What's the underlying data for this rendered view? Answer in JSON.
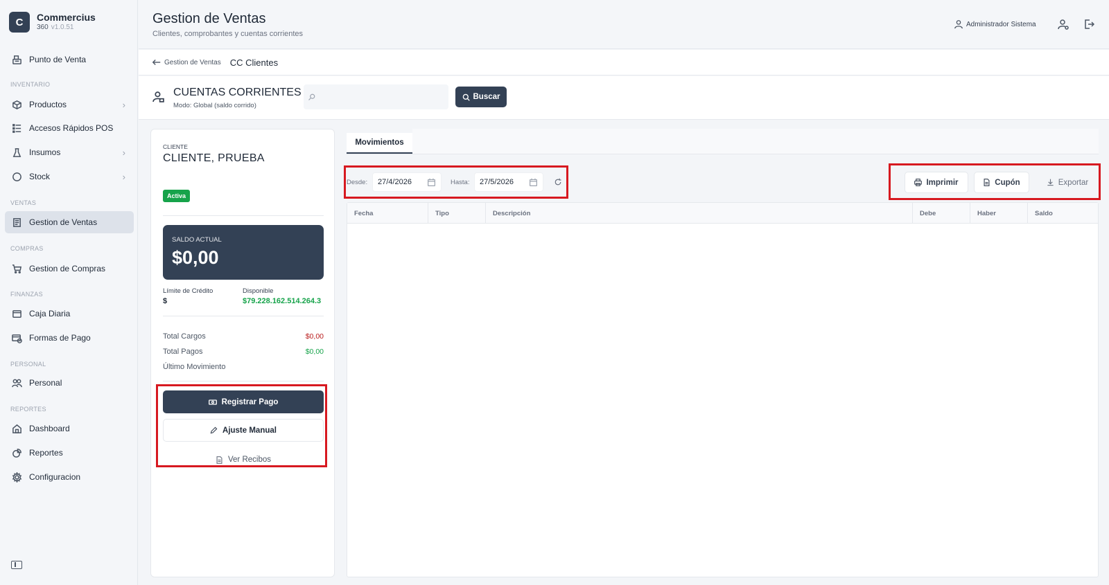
{
  "brand": {
    "logo_letter": "C",
    "name": "Commercius",
    "product": "360",
    "version": "v1.0.51"
  },
  "sidebar": {
    "items": [
      {
        "label": "Punto de Venta",
        "icon": "register-icon"
      },
      {
        "section": "INVENTARIO"
      },
      {
        "label": "Productos",
        "icon": "box-icon",
        "chevron": true
      },
      {
        "label": "Accesos Rápidos POS",
        "icon": "list-icon"
      },
      {
        "label": "Insumos",
        "icon": "flask-icon",
        "chevron": true
      },
      {
        "label": "Stock",
        "icon": "circle-icon",
        "chevron": true
      },
      {
        "section": "VENTAS"
      },
      {
        "label": "Gestion de Ventas",
        "icon": "receipt-icon",
        "active": true
      },
      {
        "section": "COMPRAS"
      },
      {
        "label": "Gestion de Compras",
        "icon": "cart-icon"
      },
      {
        "section": "FINANZAS"
      },
      {
        "label": "Caja Diaria",
        "icon": "wallet-icon"
      },
      {
        "label": "Formas de Pago",
        "icon": "card-icon"
      },
      {
        "section": "PERSONAL"
      },
      {
        "label": "Personal",
        "icon": "users-icon"
      },
      {
        "section": "REPORTES"
      },
      {
        "label": "Dashboard",
        "icon": "home-icon"
      },
      {
        "label": "Reportes",
        "icon": "chart-icon"
      },
      {
        "label": "Configuracion",
        "icon": "gear-icon"
      }
    ]
  },
  "header": {
    "title": "Gestion de Ventas",
    "subtitle": "Clientes, comprobantes y cuentas corrientes",
    "user": "Administrador Sistema"
  },
  "breadcrumb": {
    "back": "Gestion de Ventas",
    "current": "CC Clientes"
  },
  "account": {
    "title": "CUENTAS CORRIENTES",
    "mode": "Modo: Global (saldo corrido)",
    "search_placeholder": "",
    "search_button": "Buscar"
  },
  "client": {
    "label": "CLIENTE",
    "name": "CLIENTE, PRUEBA",
    "status": "Activa",
    "balance_label": "SALDO ACTUAL",
    "balance": "$0,00",
    "credit_limit_label": "Límite de Crédito",
    "credit_limit": "$",
    "available_label": "Disponible",
    "available": "$79.228.162.514.264.3",
    "total_charges_label": "Total Cargos",
    "total_charges": "$0,00",
    "total_payments_label": "Total Pagos",
    "total_payments": "$0,00",
    "last_movement_label": "Último Movimiento",
    "buttons": {
      "register_payment": "Registrar Pago",
      "manual_adjust": "Ajuste Manual",
      "view_receipts": "Ver Recibos"
    }
  },
  "movements": {
    "tab": "Movimientos",
    "from_label": "Desde:",
    "from": "27/4/2026",
    "to_label": "Hasta:",
    "to": "27/5/2026",
    "actions": {
      "print": "Imprimir",
      "coupon": "Cupón",
      "export": "Exportar"
    },
    "columns": [
      "Fecha",
      "Tipo",
      "Descripción",
      "Debe",
      "Haber",
      "Saldo"
    ],
    "rows": []
  },
  "colors": {
    "primary": "#334155",
    "success": "#16a34a",
    "danger": "#b91c1c",
    "highlight": "#d71920"
  }
}
